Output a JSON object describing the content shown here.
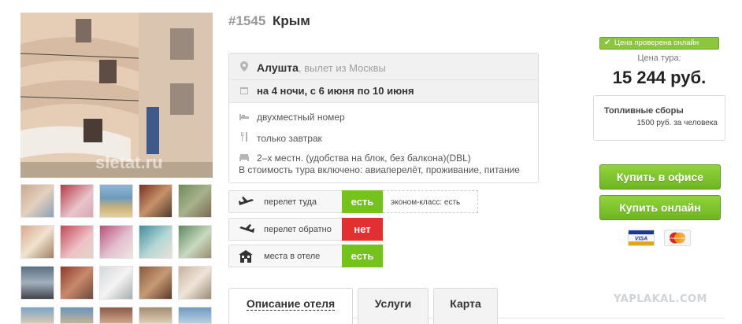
{
  "tour": {
    "number": "#1545",
    "name": "Крым"
  },
  "info": {
    "city": "Алушта",
    "departure": ", вылет из Москвы",
    "dates": "на 4 ночи, с 6 июня по 10 июня",
    "room": "двухместный номер",
    "meals": "только завтрак",
    "accommodation": "2–х местн. (удобства на блок, без балкона)(DBL)",
    "included": "В стоимость тура включено: авиаперелёт, проживание, питание"
  },
  "statuses": {
    "flight_there": {
      "label": "перелет туда",
      "value": "есть",
      "color": "#74c31b"
    },
    "flight_back": {
      "label": "перелет обратно",
      "value": "нет",
      "color": "#e22f2f"
    },
    "hotel_rooms": {
      "label": "места в отеле",
      "value": "есть",
      "color": "#74c31b"
    },
    "economy_note": "эконом-класс: есть"
  },
  "tabs": [
    "Описание отеля",
    "Услуги",
    "Карта"
  ],
  "price": {
    "verified": "Цена проверена онлайн",
    "label": "Цена тура:",
    "value": "15 244 руб.",
    "fuel_title": "Топливные сборы",
    "fuel_value": "1500 руб. за человека"
  },
  "buttons": {
    "buy_office": "Купить в офисе",
    "buy_online": "Купить онлайн"
  },
  "cards": {
    "visa": "VISA",
    "mastercard": "MasterCard"
  },
  "photo_watermark": "sletat.ru",
  "watermark": "YAPLAKAL.COM",
  "colors": {
    "accent_green": "#74c31b",
    "alert_red": "#e22f2f"
  }
}
